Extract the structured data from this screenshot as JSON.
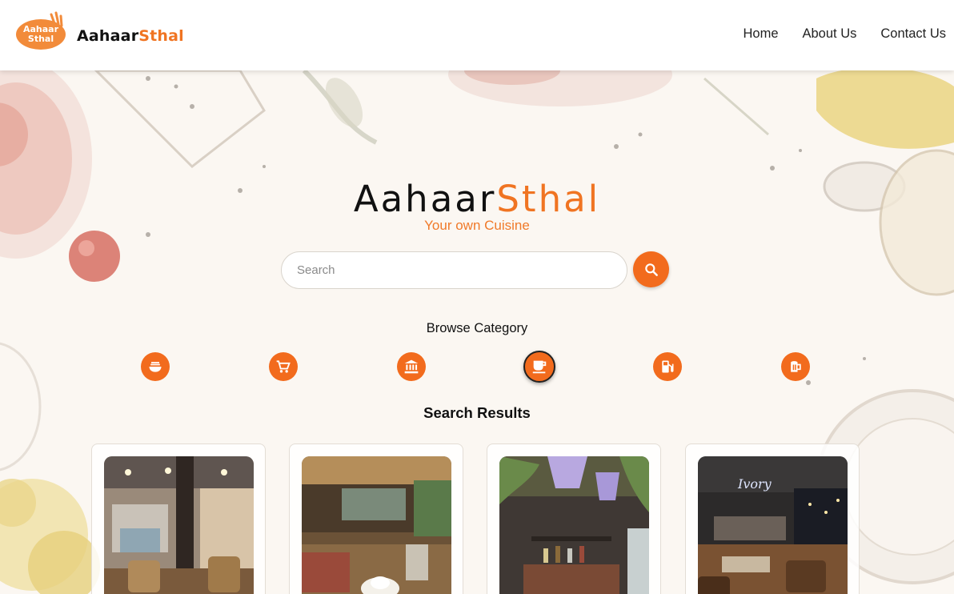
{
  "header": {
    "logo_text_line1": "Aahaar",
    "logo_text_line2": "Sthal",
    "brand_part1": "Aahaar",
    "brand_part2": "Sthal",
    "nav": [
      {
        "label": "Home"
      },
      {
        "label": "About Us"
      },
      {
        "label": "Contact Us"
      }
    ]
  },
  "hero": {
    "title_part1": "Aahaar",
    "title_part2": "Sthal",
    "tagline": "Your own Cuisine"
  },
  "search": {
    "placeholder": "Search",
    "value": "",
    "button_icon": "search-icon"
  },
  "browse": {
    "title": "Browse Category",
    "categories": [
      {
        "icon": "noodle-bowl-icon"
      },
      {
        "icon": "shopping-cart-icon"
      },
      {
        "icon": "bank-icon"
      },
      {
        "icon": "cafe-cup-icon",
        "selected": true
      },
      {
        "icon": "fuel-station-icon"
      },
      {
        "icon": "beer-mug-icon"
      }
    ]
  },
  "results": {
    "title": "Search Results",
    "items": [
      {
        "image": "restaurant-interior-photo"
      },
      {
        "image": "cafe-coffee-table-photo"
      },
      {
        "image": "bar-counter-photo"
      },
      {
        "image": "neon-sign-dining-photo"
      }
    ]
  },
  "colors": {
    "accent": "#f26b1d",
    "brand_orange": "#f07422",
    "background": "#fbf7f2"
  }
}
